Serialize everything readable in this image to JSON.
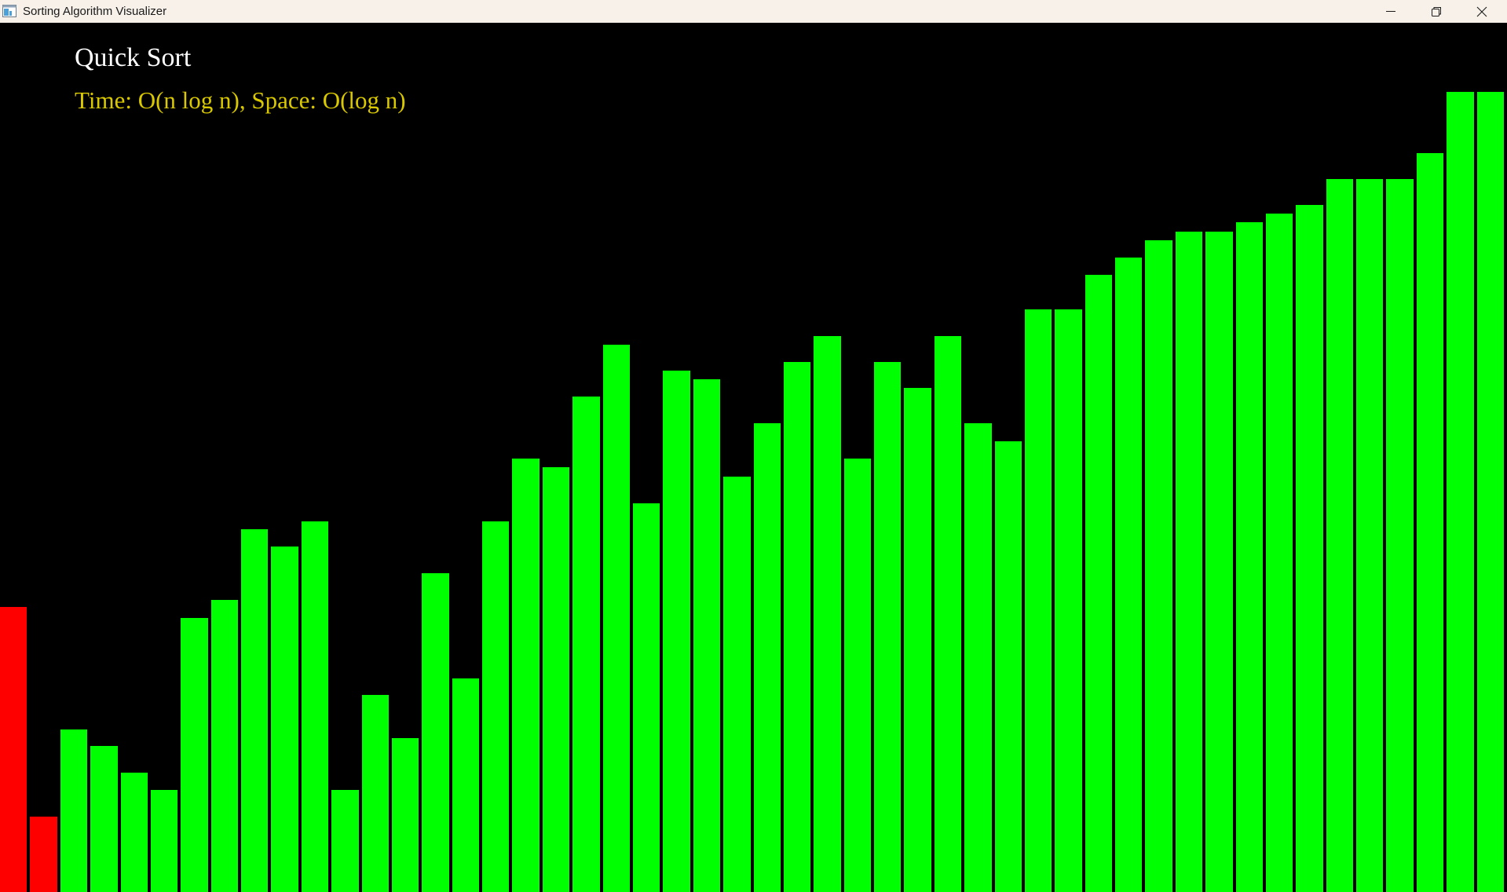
{
  "window": {
    "title": "Sorting Algorithm Visualizer"
  },
  "visualizer": {
    "algorithm_name": "Quick Sort",
    "complexity": "Time: O(n log n), Space: O(log n)",
    "colors": {
      "background": "#000000",
      "bar_default": "#00ff00",
      "bar_active": "#ff0000",
      "title": "#ffffff",
      "complexity": "#d9c800"
    }
  },
  "chart_data": {
    "type": "bar",
    "title": "",
    "xlabel": "",
    "ylabel": "",
    "ylim": [
      0,
      1
    ],
    "values": [
      0.3565,
      0.0941,
      0.2036,
      0.1823,
      0.1493,
      0.128,
      0.3429,
      0.3652,
      0.4532,
      0.4319,
      0.4629,
      0.128,
      0.2463,
      0.192,
      0.3982,
      0.2667,
      0.4629,
      0.5413,
      0.5306,
      0.6194,
      0.6841,
      0.4855,
      0.6518,
      0.6411,
      0.5189,
      0.5858,
      0.6627,
      0.6951,
      0.5414,
      0.6627,
      0.63,
      0.6951,
      0.5858,
      0.5636,
      0.7281,
      0.7281,
      0.771,
      0.793,
      0.8147,
      0.8256,
      0.8256,
      0.8367,
      0.8476,
      0.8585,
      0.891,
      0.891,
      0.891,
      0.9239,
      1.0,
      1.0
    ],
    "highlighted_indices": [
      0,
      1
    ]
  }
}
